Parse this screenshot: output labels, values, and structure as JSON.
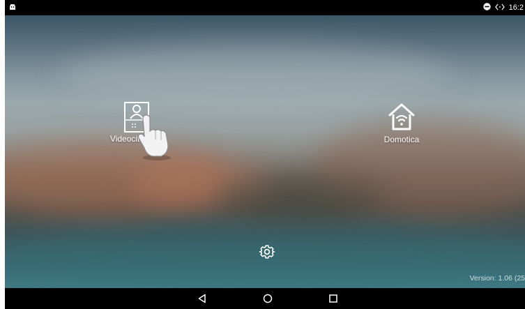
{
  "status_bar": {
    "time": "16:2",
    "left_icon": "android-icon",
    "icons": [
      "minus-circle-icon",
      "code-brackets-icon"
    ]
  },
  "home": {
    "apps": [
      {
        "label": "Videocitofonia",
        "icon": "intercom-icon"
      },
      {
        "label": "Domotica",
        "icon": "smart-home-wifi-icon"
      }
    ],
    "settings_icon": "gear-icon",
    "version": "Version: 1.06 (25"
  },
  "overlay": {
    "icon": "tap-hand-icon"
  },
  "nav": {
    "buttons": [
      "back-icon",
      "home-icon",
      "recents-icon"
    ]
  }
}
